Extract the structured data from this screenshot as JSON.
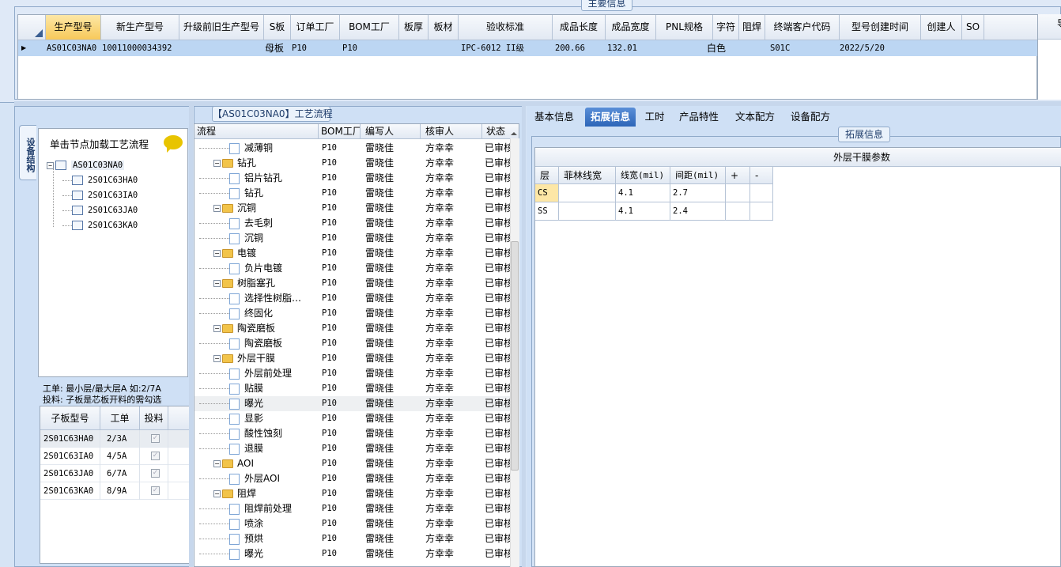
{
  "main_info": {
    "title": "主要信息",
    "columns": [
      "生产型号",
      "新生产型号",
      "升级前旧生产型号",
      "S板",
      "订单工厂",
      "BOM工厂",
      "板厚",
      "板材",
      "验收标准",
      "成品长度",
      "成品宽度",
      "PNL规格",
      "字符",
      "阻焊",
      "终端客户代码",
      "型号创建时间",
      "创建人",
      "SO"
    ],
    "row": {
      "prod_model": "AS01C03NA0",
      "new_model": "10011000034392",
      "s_board": "母板",
      "order_factory": "P10",
      "bom_factory": "P10",
      "standard": "IPC-6012 II级",
      "length": "200.66",
      "width": "132.01",
      "char": "白色",
      "customer_code": "S01C",
      "created": "2022/5/20"
    },
    "right_header": "导"
  },
  "left_panel": {
    "vertical_tab": "设备结构",
    "hint": "单击节点加载工艺流程",
    "tree_root": "AS01C03NA0",
    "tree_children": [
      "2S01C63HA0",
      "2S01C63IA0",
      "2S01C63JA0",
      "2S01C63KA0"
    ],
    "note1": "工单: 最小层/最大层A 如:2/7A",
    "note2": "投料: 子板是芯板开料的需勾选",
    "sub_columns": [
      "子板型号",
      "工单",
      "投料"
    ],
    "sub_rows": [
      {
        "model": "2S01C63HA0",
        "order": "2/3A"
      },
      {
        "model": "2S01C63IA0",
        "order": "4/5A"
      },
      {
        "model": "2S01C63JA0",
        "order": "6/7A"
      },
      {
        "model": "2S01C63KA0",
        "order": "8/9A"
      }
    ]
  },
  "process_flow": {
    "title": "【AS01C03NA0】工艺流程",
    "columns": [
      "流程",
      "BOM工厂",
      "编写人",
      "核审人",
      "状态"
    ],
    "factory": "P10",
    "writer": "雷晓佳",
    "reviewer": "方幸幸",
    "status": "已审核",
    "rows": [
      {
        "name": "减薄铜",
        "level": 1
      },
      {
        "name": "钻孔",
        "level": 0
      },
      {
        "name": "铝片钻孔",
        "level": 1
      },
      {
        "name": "钻孔",
        "level": 1
      },
      {
        "name": "沉铜",
        "level": 0
      },
      {
        "name": "去毛刺",
        "level": 1
      },
      {
        "name": "沉铜",
        "level": 1
      },
      {
        "name": "电镀",
        "level": 0
      },
      {
        "name": "负片电镀",
        "level": 1
      },
      {
        "name": "树脂塞孔",
        "level": 0
      },
      {
        "name": "选择性树脂…",
        "level": 1
      },
      {
        "name": "终固化",
        "level": 1
      },
      {
        "name": "陶瓷磨板",
        "level": 0
      },
      {
        "name": "陶瓷磨板",
        "level": 1
      },
      {
        "name": "外层干膜",
        "level": 0
      },
      {
        "name": "外层前处理",
        "level": 1
      },
      {
        "name": "贴膜",
        "level": 1
      },
      {
        "name": "曝光",
        "level": 1
      },
      {
        "name": "显影",
        "level": 1
      },
      {
        "name": "酸性蚀刻",
        "level": 1
      },
      {
        "name": "退膜",
        "level": 1
      },
      {
        "name": "AOI",
        "level": 0
      },
      {
        "name": "外层AOI",
        "level": 1
      },
      {
        "name": "阻焊",
        "level": 0
      },
      {
        "name": "阻焊前处理",
        "level": 1
      },
      {
        "name": "喷涂",
        "level": 1
      },
      {
        "name": "预烘",
        "level": 1
      },
      {
        "name": "曝光",
        "level": 1
      }
    ]
  },
  "right_panel": {
    "tabs": [
      "基本信息",
      "拓展信息",
      "工时",
      "产品特性",
      "文本配方",
      "设备配方"
    ],
    "active_tab": "拓展信息",
    "frame_title": "拓展信息",
    "table_title": "外层干膜参数",
    "columns": [
      "层",
      "菲林线宽",
      "线宽(mil)",
      "间距(mil)",
      "+",
      "-"
    ],
    "rows": [
      {
        "layer": "CS",
        "film": "",
        "width": "4.1",
        "spacing": "2.7"
      },
      {
        "layer": "SS",
        "film": "",
        "width": "4.1",
        "spacing": "2.4"
      }
    ]
  },
  "colors": {
    "accent": "#2d65b8",
    "header_selected": "#f7c95a",
    "row_selected": "#bcd6f3",
    "folder": "#f2c44a"
  }
}
